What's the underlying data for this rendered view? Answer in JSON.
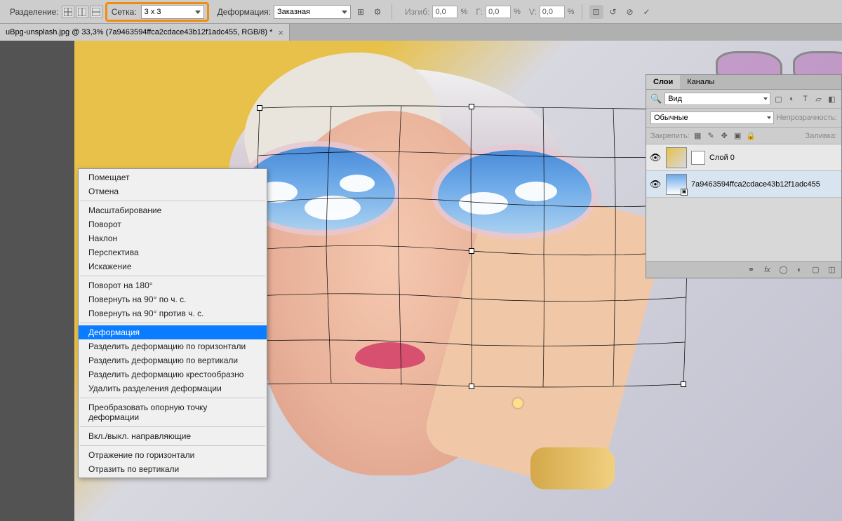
{
  "options_bar": {
    "split_label": "Разделение:",
    "grid_label": "Сетка:",
    "grid_value": "3 x 3",
    "warp_label": "Деформация:",
    "warp_value": "Заказная",
    "bend_label": "Изгиб:",
    "bend_value": "0,0",
    "h_label": "Г:",
    "h_value": "0,0",
    "v_label": "V:",
    "v_value": "0,0",
    "pct": "%"
  },
  "document_tab": {
    "title": "uBpg-unsplash.jpg @ 33,3% (7a9463594ffca2cdace43b12f1adc455, RGB/8) *"
  },
  "context_menu": {
    "items": [
      {
        "label": "Помещает",
        "type": "item"
      },
      {
        "label": "Отмена",
        "type": "item"
      },
      {
        "type": "sep"
      },
      {
        "label": "Масштабирование",
        "type": "item"
      },
      {
        "label": "Поворот",
        "type": "item"
      },
      {
        "label": "Наклон",
        "type": "item"
      },
      {
        "label": "Перспектива",
        "type": "item"
      },
      {
        "label": "Искажение",
        "type": "item"
      },
      {
        "type": "sep"
      },
      {
        "label": "Поворот на 180°",
        "type": "item"
      },
      {
        "label": "Повернуть на 90° по ч. с.",
        "type": "item"
      },
      {
        "label": "Повернуть на 90° против ч. с.",
        "type": "item"
      },
      {
        "type": "sep"
      },
      {
        "label": "Деформация",
        "type": "item",
        "highlighted": true
      },
      {
        "label": "Разделить деформацию по горизонтали",
        "type": "item"
      },
      {
        "label": "Разделить деформацию по вертикали",
        "type": "item"
      },
      {
        "label": "Разделить деформацию крестообразно",
        "type": "item"
      },
      {
        "label": "Удалить разделения деформации",
        "type": "item"
      },
      {
        "type": "sep"
      },
      {
        "label": "Преобразовать опорную точку деформации",
        "type": "item"
      },
      {
        "type": "sep"
      },
      {
        "label": "Вкл./выкл. направляющие",
        "type": "item"
      },
      {
        "type": "sep"
      },
      {
        "label": "Отражение по горизонтали",
        "type": "item"
      },
      {
        "label": "Отразить по вертикали",
        "type": "item"
      }
    ]
  },
  "layers_panel": {
    "tab_layers": "Слои",
    "tab_channels": "Каналы",
    "search_kind": "Вид",
    "blend_mode": "Обычные",
    "opacity_label": "Непрозрачность:",
    "lock_label": "Закрепить:",
    "fill_label": "Заливка:",
    "layers": [
      {
        "name": "Слой 0",
        "visible": true
      },
      {
        "name": "7a9463594ffca2cdace43b12f1adc455",
        "visible": true
      }
    ]
  }
}
